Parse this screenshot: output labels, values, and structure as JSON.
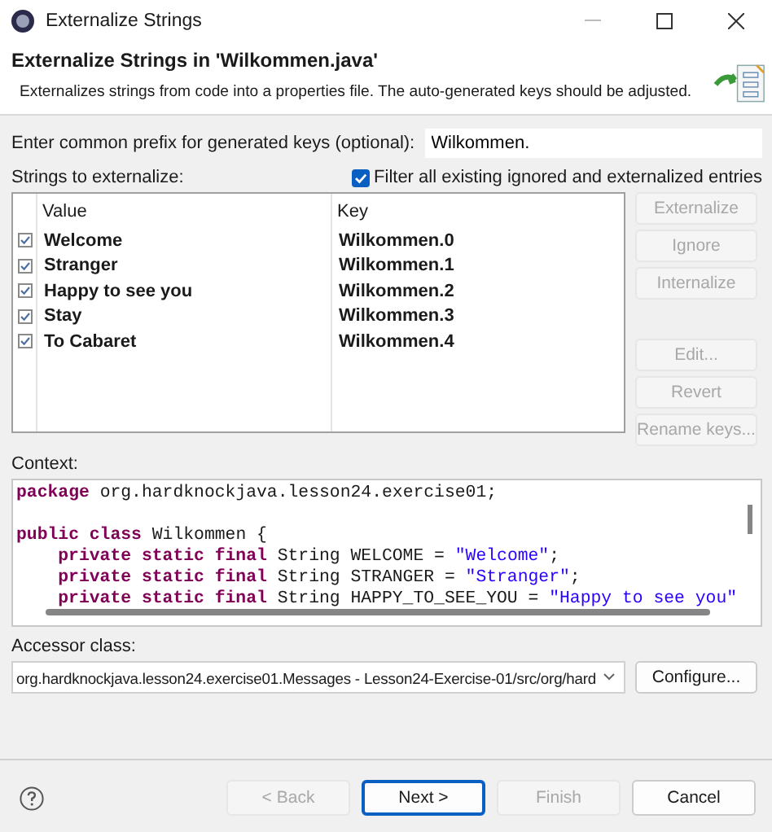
{
  "window": {
    "title": "Externalize Strings"
  },
  "header": {
    "title": "Externalize Strings in 'Wilkommen.java'",
    "description": "Externalizes strings from code into a properties file. The auto-generated keys should be adjusted."
  },
  "prefix": {
    "label": "Enter common prefix for generated keys (optional):",
    "value": "Wilkommen."
  },
  "strings_label": "Strings to externalize:",
  "filter": {
    "label": "Filter all existing ignored and externalized entries",
    "checked": true
  },
  "table": {
    "columns": [
      "Value",
      "Key"
    ],
    "rows": [
      {
        "checked": true,
        "value": "Welcome",
        "key": "Wilkommen.0"
      },
      {
        "checked": true,
        "value": "Stranger",
        "key": "Wilkommen.1"
      },
      {
        "checked": true,
        "value": "Happy to see you",
        "key": "Wilkommen.2"
      },
      {
        "checked": true,
        "value": "Stay",
        "key": "Wilkommen.3"
      },
      {
        "checked": true,
        "value": "To Cabaret",
        "key": "Wilkommen.4"
      }
    ]
  },
  "side_button_groups": [
    [
      {
        "label": "Externalize",
        "disabled": true
      },
      {
        "label": "Ignore",
        "disabled": true
      },
      {
        "label": "Internalize",
        "disabled": true
      }
    ],
    [
      {
        "label": "Edit...",
        "disabled": true
      },
      {
        "label": "Revert",
        "disabled": true
      },
      {
        "label": "Rename keys...",
        "disabled": true
      }
    ]
  ],
  "context": {
    "label": "Context:",
    "lines": [
      {
        "kind": "code",
        "tokens": [
          {
            "kind": "keyword",
            "text": "package"
          },
          {
            "kind": "plain",
            "text": " org.hardknockjava.lesson24.exercise01;"
          }
        ]
      },
      {
        "kind": "blank"
      },
      {
        "kind": "code",
        "tokens": [
          {
            "kind": "keyword",
            "text": "public class"
          },
          {
            "kind": "plain",
            "text": " Wilkommen {"
          }
        ]
      },
      {
        "kind": "indented",
        "tokens": [
          {
            "kind": "keyword",
            "text": "private static final"
          },
          {
            "kind": "plain",
            "text": " String WELCOME = "
          },
          {
            "kind": "string",
            "text": "\"Welcome\""
          },
          {
            "kind": "plain",
            "text": ";"
          }
        ]
      },
      {
        "kind": "indented",
        "tokens": [
          {
            "kind": "keyword",
            "text": "private static final"
          },
          {
            "kind": "plain",
            "text": " String STRANGER = "
          },
          {
            "kind": "string",
            "text": "\"Stranger\""
          },
          {
            "kind": "plain",
            "text": ";"
          }
        ]
      },
      {
        "kind": "indented",
        "tokens": [
          {
            "kind": "keyword",
            "text": "private static final"
          },
          {
            "kind": "plain",
            "text": " String HAPPY_TO_SEE_YOU = "
          },
          {
            "kind": "string",
            "text": "\"Happy to see you\""
          }
        ]
      }
    ]
  },
  "accessor": {
    "label": "Accessor class:",
    "value": "org.hardknockjava.lesson24.exercise01.Messages - Lesson24-Exercise-01/src/org/hard",
    "button": "Configure..."
  },
  "footer_buttons": [
    {
      "label": "< Back",
      "disabled": true,
      "default": false
    },
    {
      "label": "Next >",
      "disabled": false,
      "default": true
    },
    {
      "label": "Finish",
      "disabled": true,
      "default": false
    },
    {
      "label": "Cancel",
      "disabled": false,
      "default": false
    }
  ]
}
